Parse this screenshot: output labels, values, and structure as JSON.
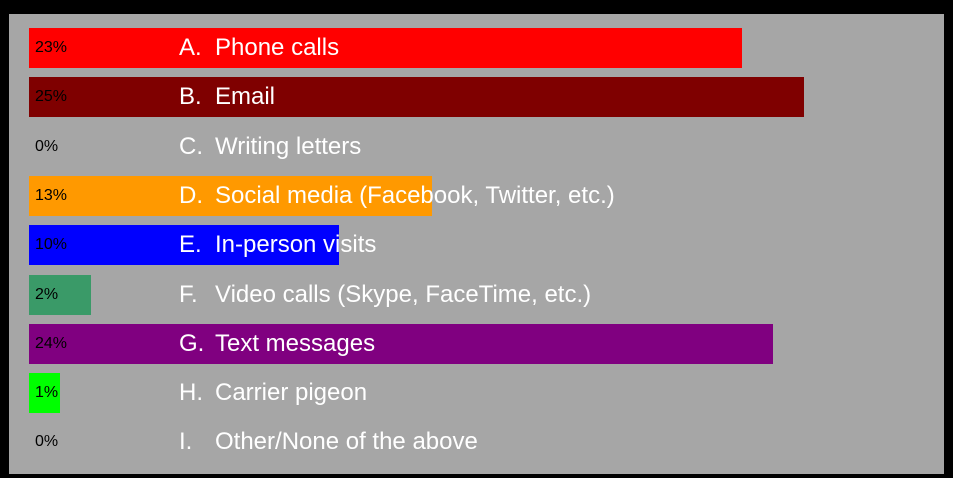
{
  "chart_data": {
    "type": "bar",
    "orientation": "horizontal",
    "title": "",
    "xlabel": "",
    "ylabel": "",
    "xlim": [
      0,
      25
    ],
    "grid": false,
    "legend": "none",
    "background_color": "#a6a6a6",
    "categories": [
      "Phone calls",
      "Email",
      "Writing letters",
      "Social media (Facebook, Twitter, etc.)",
      "In-person visits",
      "Video calls (Skype, FaceTime, etc.)",
      "Text messages",
      "Carrier pigeon",
      "Other/None of the above"
    ],
    "letters": [
      "A.",
      "B.",
      "C.",
      "D.",
      "E.",
      "F.",
      "G.",
      "H.",
      "I."
    ],
    "values": [
      23,
      25,
      0,
      13,
      10,
      2,
      24,
      1,
      0
    ],
    "value_labels": [
      "23%",
      "25%",
      "0%",
      "13%",
      "10%",
      "2%",
      "24%",
      "1%",
      "0%"
    ],
    "colors": [
      "#ff0000",
      "#7f0000",
      "#a6a6a6",
      "#ff9900",
      "#0000ff",
      "#3a9a68",
      "#800080",
      "#00ff00",
      "#a6a6a6"
    ]
  }
}
